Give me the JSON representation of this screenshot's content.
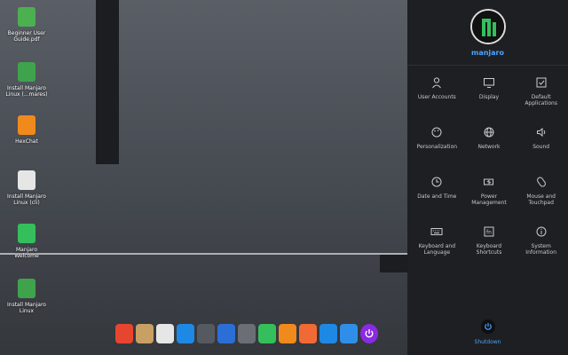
{
  "desktop": {
    "icons": [
      {
        "label": "Beginner User\nGuide.pdf",
        "icon": "pdf-document-icon",
        "color": "#4caf50"
      },
      {
        "label": "Install Manjaro\nLinux (...mares)",
        "icon": "installer-icon",
        "color": "#3fa34d"
      },
      {
        "label": "HexChat",
        "icon": "hexchat-icon",
        "color": "#f08a1c"
      },
      {
        "label": "Install Manjaro\nLinux (cli)",
        "icon": "terminal-installer-icon",
        "color": "#e6e6e6"
      },
      {
        "label": "Manjaro\nWelcome",
        "icon": "manjaro-logo-icon",
        "color": "#35bf5c"
      },
      {
        "label": "Install Manjaro\nLinux",
        "icon": "installer-box-icon",
        "color": "#3fa34d"
      }
    ]
  },
  "panel": {
    "username": "manjaro",
    "items": [
      {
        "label": "User Accounts",
        "icon": "user-icon"
      },
      {
        "label": "Display",
        "icon": "monitor-icon"
      },
      {
        "label": "Default\nApplications",
        "icon": "default-apps-icon"
      },
      {
        "label": "Personalization",
        "icon": "palette-icon"
      },
      {
        "label": "Network",
        "icon": "network-globe-icon"
      },
      {
        "label": "Sound",
        "icon": "speaker-icon"
      },
      {
        "label": "Date and Time",
        "icon": "clock-icon"
      },
      {
        "label": "Power\nManagement",
        "icon": "battery-icon"
      },
      {
        "label": "Mouse and\nTouchpad",
        "icon": "mouse-icon"
      },
      {
        "label": "Keyboard and\nLanguage",
        "icon": "keyboard-icon"
      },
      {
        "label": "Keyboard\nShortcuts",
        "icon": "shortcut-key-icon"
      },
      {
        "label": "System\nInformation",
        "icon": "info-icon"
      }
    ],
    "shutdown_label": "Shutdown",
    "accent": "#4aa3ff"
  },
  "dock": {
    "items": [
      {
        "icon": "launcher-rocket-icon",
        "color": "#e8452f"
      },
      {
        "icon": "file-manager-icon",
        "color": "#c8a064"
      },
      {
        "icon": "installer-cli-icon",
        "color": "#e6e6e6"
      },
      {
        "icon": "browser-icon",
        "color": "#1e88e5"
      },
      {
        "icon": "music-player-icon",
        "color": "#555a60"
      },
      {
        "icon": "video-player-icon",
        "color": "#2b6fd6"
      },
      {
        "icon": "terminal-icon",
        "color": "#6b6f75"
      },
      {
        "icon": "manjaro-icon",
        "color": "#35bf5c"
      },
      {
        "icon": "hexchat-icon",
        "color": "#f08a1c"
      },
      {
        "icon": "battery-app-icon",
        "color": "#f06a36"
      },
      {
        "icon": "web-browser-icon",
        "color": "#1e88e5"
      },
      {
        "icon": "settings-flower-icon",
        "color": "#2f8fe8"
      },
      {
        "icon": "power-icon",
        "color": "#8a2be2"
      }
    ]
  }
}
